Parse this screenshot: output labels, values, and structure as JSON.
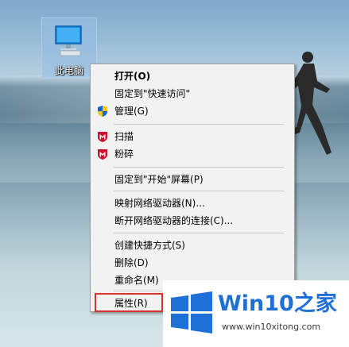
{
  "desktop": {
    "icon_label": "此电脑"
  },
  "context_menu": {
    "items": [
      {
        "label": "打开(O)"
      },
      {
        "label": "固定到\"快速访问\""
      },
      {
        "label": "管理(G)"
      },
      {
        "label": "扫描"
      },
      {
        "label": "粉碎"
      },
      {
        "label": "固定到\"开始\"屏幕(P)"
      },
      {
        "label": "映射网络驱动器(N)..."
      },
      {
        "label": "断开网络驱动器的连接(C)..."
      },
      {
        "label": "创建快捷方式(S)"
      },
      {
        "label": "删除(D)"
      },
      {
        "label": "重命名(M)"
      },
      {
        "label": "属性(R)"
      }
    ]
  },
  "watermark": {
    "brand_prefix": "Win10",
    "brand_suffix": "之家",
    "url": "www.win10xitong.com"
  },
  "colors": {
    "highlight": "#d9302b",
    "brand": "#1e6fd6",
    "shield_red": "#c8102e"
  }
}
